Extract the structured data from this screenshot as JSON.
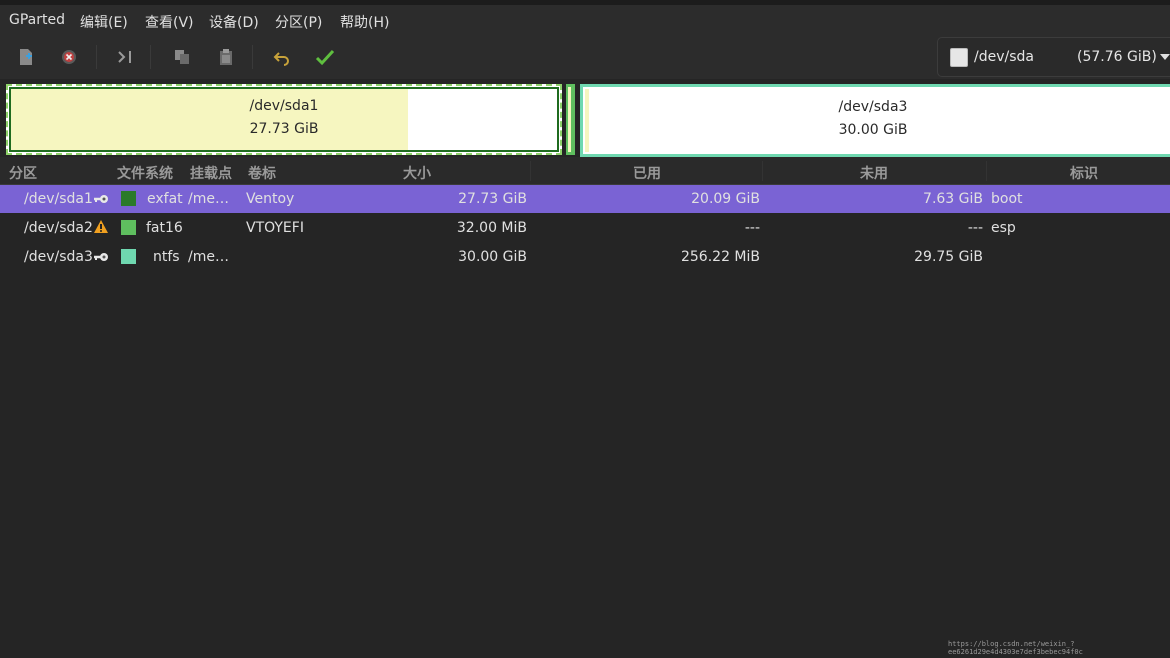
{
  "menubar": {
    "items": [
      "GParted",
      "编辑(E)",
      "查看(V)",
      "设备(D)",
      "分区(P)",
      "帮助(H)"
    ]
  },
  "toolbar": {
    "buttons": [
      "new-icon",
      "delete-icon",
      "resize-move-icon",
      "copy-icon",
      "paste-icon",
      "undo-icon",
      "apply-icon"
    ]
  },
  "device": {
    "name": "/dev/sda",
    "size": "(57.76 GiB)"
  },
  "diskmap": {
    "partitions": [
      {
        "name": "/dev/sda1",
        "size": "27.73 GiB"
      },
      {
        "name": "/dev/sda3",
        "size": "30.00 GiB"
      }
    ]
  },
  "table": {
    "headers": [
      "分区",
      "文件系统",
      "挂载点",
      "卷标",
      "大小",
      "已用",
      "未用",
      "标识"
    ],
    "rows": [
      {
        "partition": "/dev/sda1",
        "icon": "key-icon",
        "fs": "exfat",
        "fs_color": "#2a7a2a",
        "mount": "/me…",
        "label": "Ventoy",
        "size": "27.73 GiB",
        "used": "20.09 GiB",
        "unused": "7.63 GiB",
        "flags": "boot",
        "selected": true
      },
      {
        "partition": "/dev/sda2",
        "icon": "warning-icon",
        "fs": "fat16",
        "fs_color": "#5fbf5f",
        "mount": "",
        "label": "VTOYEFI",
        "size": "32.00 MiB",
        "used": "---",
        "unused": "---",
        "flags": "esp",
        "selected": false
      },
      {
        "partition": "/dev/sda3",
        "icon": "key-icon",
        "fs": "ntfs",
        "fs_color": "#6fd8b0",
        "mount": "/me…",
        "label": "",
        "size": "30.00 GiB",
        "used": "256.22 MiB",
        "unused": "29.75 GiB",
        "flags": "",
        "selected": false
      }
    ]
  },
  "watermark": "https://blog.csdn.net/weixin_?ee6261d29e4d4303e7def3bebec94f0c"
}
